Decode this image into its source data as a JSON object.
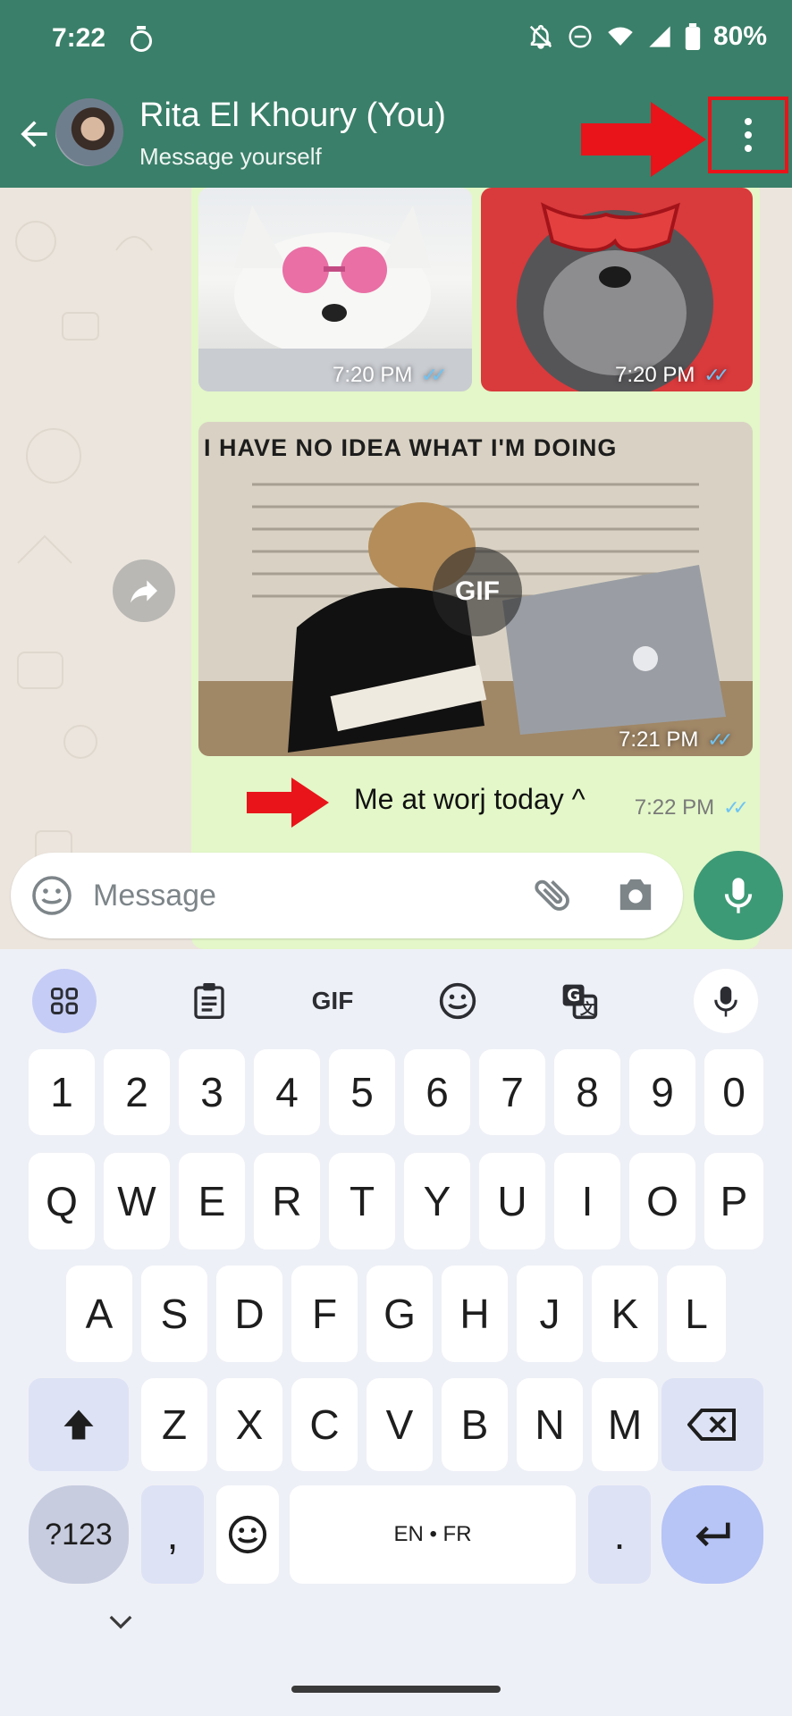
{
  "status_bar": {
    "time": "7:22",
    "battery": "80%"
  },
  "header": {
    "title": "Rita El Khoury (You)",
    "subtitle": "Message yourself"
  },
  "messages": {
    "img1_time": "7:20 PM",
    "img2_time": "7:20 PM",
    "gif_caption": "I HAVE NO IDEA WHAT I'M DOING",
    "gif_badge": "GIF",
    "gif_time": "7:21 PM",
    "text": "Me at worj today ^",
    "text_time": "7:22 PM"
  },
  "composer": {
    "placeholder": "Message"
  },
  "keyboard": {
    "toolbar_gif": "GIF",
    "row_numbers": [
      "1",
      "2",
      "3",
      "4",
      "5",
      "6",
      "7",
      "8",
      "9",
      "0"
    ],
    "row_q": [
      "Q",
      "W",
      "E",
      "R",
      "T",
      "Y",
      "U",
      "I",
      "O",
      "P"
    ],
    "row_a": [
      "A",
      "S",
      "D",
      "F",
      "G",
      "H",
      "J",
      "K",
      "L"
    ],
    "row_z": [
      "Z",
      "X",
      "C",
      "V",
      "B",
      "N",
      "M"
    ],
    "sym_key": "?123",
    "comma_key": ",",
    "space_label": "EN • FR",
    "period_key": "."
  },
  "colors": {
    "header": "#3a7f69",
    "bubble": "#e3f7c8",
    "accent": "#3d9a76",
    "annotation": "#e8141a"
  }
}
